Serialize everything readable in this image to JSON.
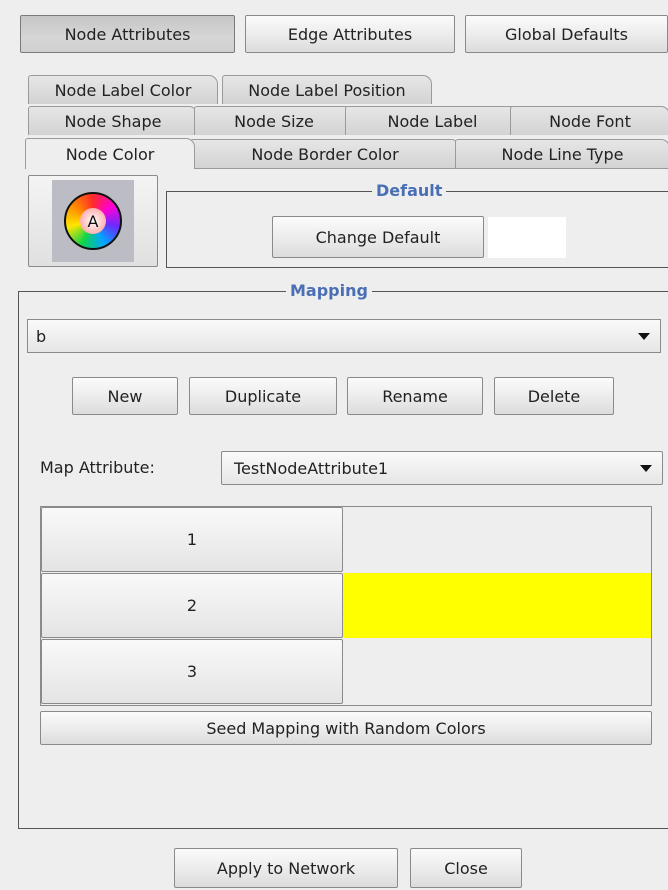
{
  "top_tabs": [
    {
      "label": "Node Attributes",
      "selected": true
    },
    {
      "label": "Edge Attributes",
      "selected": false
    },
    {
      "label": "Global Defaults",
      "selected": false
    }
  ],
  "property_tabs": {
    "row1": [
      "Node Label Color",
      "Node Label Position"
    ],
    "row2": [
      "Node Shape",
      "Node Size",
      "Node Label",
      "Node Font"
    ],
    "row3": [
      "Node Color",
      "Node Border Color",
      "Node Line Type"
    ],
    "active": "Node Color"
  },
  "default": {
    "title": "Default",
    "icon_letter": "A",
    "change_label": "Change Default",
    "swatch_color": "#ffffff"
  },
  "mapping": {
    "title": "Mapping",
    "selected_mapping": "b",
    "buttons": [
      "New",
      "Duplicate",
      "Rename",
      "Delete"
    ],
    "map_attribute_label": "Map Attribute:",
    "map_attribute_value": "TestNodeAttribute1",
    "rows": [
      {
        "key": "1",
        "color": null
      },
      {
        "key": "2",
        "color": "#ffff00"
      },
      {
        "key": "3",
        "color": null
      }
    ],
    "seed_label": "Seed Mapping with Random Colors"
  },
  "footer": {
    "apply_label": "Apply to Network",
    "close_label": "Close"
  }
}
